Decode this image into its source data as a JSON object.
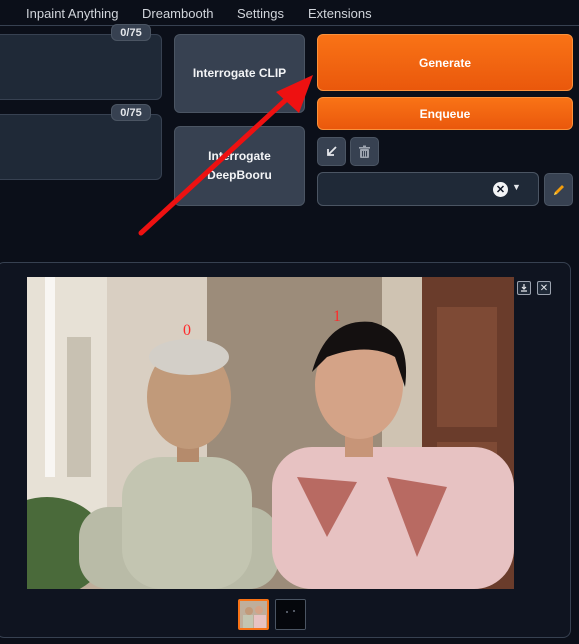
{
  "tabs": [
    "Inpaint Anything",
    "Dreambooth",
    "Settings",
    "Extensions"
  ],
  "prompt": {
    "token_counter": "0/75"
  },
  "negative_prompt": {
    "token_counter": "0/75"
  },
  "buttons": {
    "interrogate_clip": "Interrogate CLIP",
    "interrogate_deepbooru": "Interrogate DeepBooru",
    "generate": "Generate",
    "enqueue": "Enqueue"
  },
  "icons": {
    "paste": "arrow-down-left-icon",
    "trash": "trash-icon",
    "clear": "close-icon",
    "dropdown": "chevron-down-icon",
    "edit": "pencil-icon",
    "download": "download-icon",
    "close": "close-icon"
  },
  "image": {
    "face_labels": [
      "0",
      "1"
    ]
  },
  "colors": {
    "accent": "#f97316",
    "annotation_arrow": "#ee1111",
    "background": "#0b0f19"
  }
}
